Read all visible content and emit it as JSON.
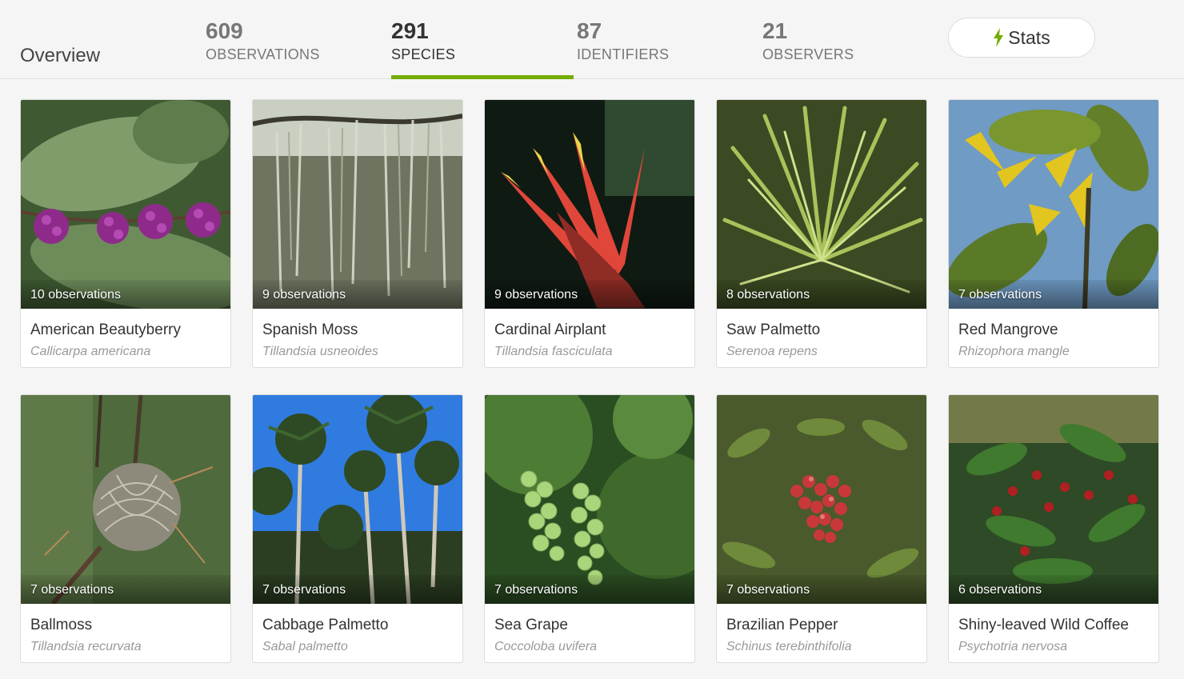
{
  "header": {
    "overview_label": "Overview",
    "stats": [
      {
        "value": "609",
        "label": "OBSERVATIONS"
      },
      {
        "value": "291",
        "label": "SPECIES"
      },
      {
        "value": "87",
        "label": "IDENTIFIERS"
      },
      {
        "value": "21",
        "label": "OBSERVERS"
      }
    ],
    "active_tab": "SPECIES",
    "stats_button_label": "Stats",
    "accent_color": "#74ac00"
  },
  "species": [
    {
      "common": "American Beautyberry",
      "scientific": "Callicarpa americana",
      "observations": "10 observations",
      "photo": "beautyberry"
    },
    {
      "common": "Spanish Moss",
      "scientific": "Tillandsia usneoides",
      "observations": "9 observations",
      "photo": "spanish-moss"
    },
    {
      "common": "Cardinal Airplant",
      "scientific": "Tillandsia fasciculata",
      "observations": "9 observations",
      "photo": "airplant"
    },
    {
      "common": "Saw Palmetto",
      "scientific": "Serenoa repens",
      "observations": "8 observations",
      "photo": "saw-palmetto"
    },
    {
      "common": "Red Mangrove",
      "scientific": "Rhizophora mangle",
      "observations": "7 observations",
      "photo": "mangrove"
    },
    {
      "common": "Ballmoss",
      "scientific": "Tillandsia recurvata",
      "observations": "7 observations",
      "photo": "ballmoss"
    },
    {
      "common": "Cabbage Palmetto",
      "scientific": "Sabal palmetto",
      "observations": "7 observations",
      "photo": "cabbage-palmetto"
    },
    {
      "common": "Sea Grape",
      "scientific": "Coccoloba uvifera",
      "observations": "7 observations",
      "photo": "sea-grape"
    },
    {
      "common": "Brazilian Pepper",
      "scientific": "Schinus terebinthifolia",
      "observations": "7 observations",
      "photo": "brazilian-pepper"
    },
    {
      "common": "Shiny-leaved Wild Coffee",
      "scientific": "Psychotria nervosa",
      "observations": "6 observations",
      "photo": "wild-coffee"
    }
  ]
}
